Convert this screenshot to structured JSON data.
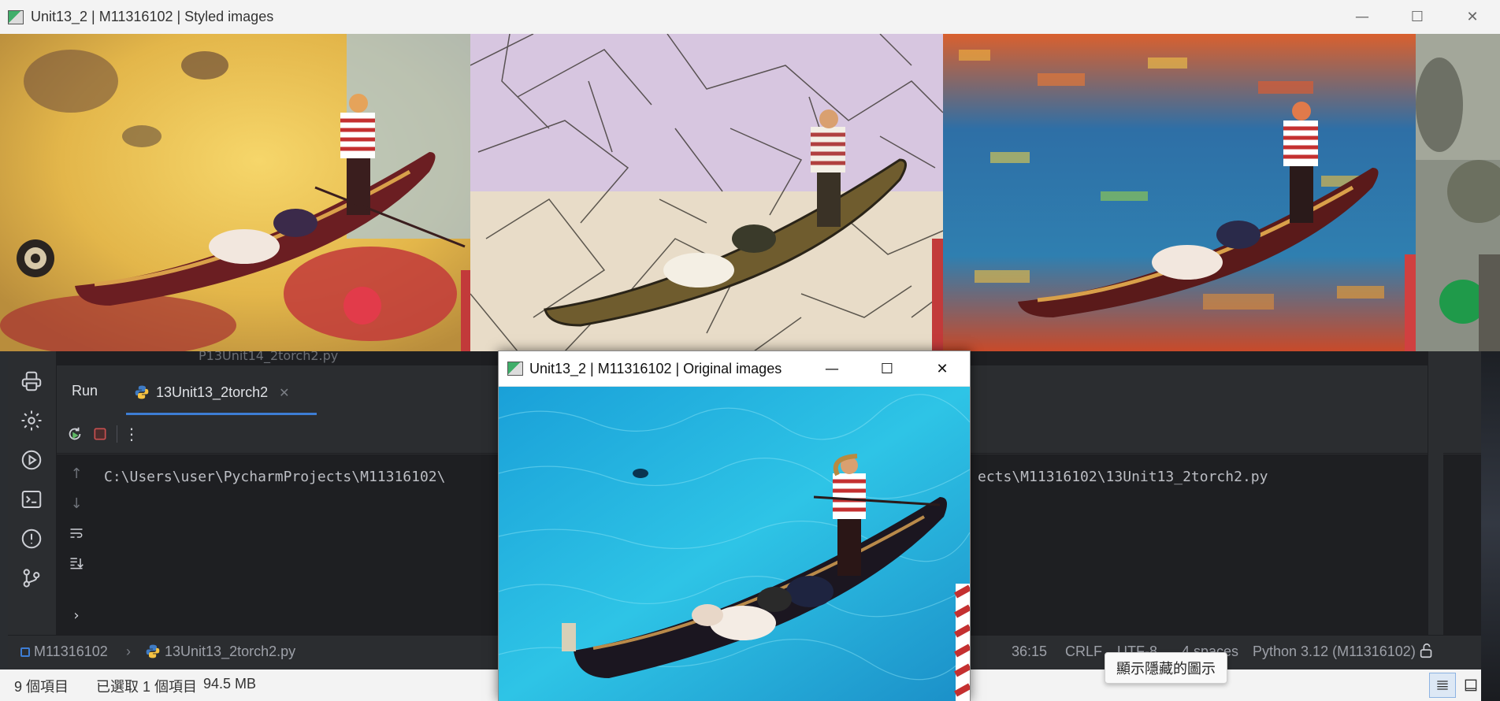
{
  "styled_window": {
    "title": "Unit13_2 | M11316102 | Styled images",
    "controls": [
      "minimize",
      "maximize",
      "close"
    ]
  },
  "styled_images": [
    {
      "name": "gondola-styled-1",
      "style": "painted-warm"
    },
    {
      "name": "gondola-styled-2",
      "style": "mosaic"
    },
    {
      "name": "gondola-styled-3",
      "style": "impressionist"
    },
    {
      "name": "gondola-styled-4",
      "style": "partial"
    }
  ],
  "ide": {
    "editor_tab_ghost": "P13Unit14_2torch2.py",
    "run_label": "Run",
    "run_tab_label": "13Unit13_2torch2",
    "console_line_left": "C:\\Users\\user\\PycharmProjects\\M11316102\\",
    "console_line_right": "ects\\M11316102\\13Unit13_2torch2.py",
    "left_toolbar_icons": [
      "python-packages-icon",
      "services-icon",
      "run-icon",
      "terminal-icon",
      "problems-icon",
      "git-icon"
    ],
    "status": {
      "project": "M11316102",
      "file": "13Unit13_2torch2.py",
      "position": "36:15",
      "line_ending": "CRLF",
      "encoding": "UTF-8",
      "indent": "4 spaces",
      "interpreter": "Python 3.12 (M11316102)"
    }
  },
  "explorer_status": {
    "item_count": "9 個項目",
    "selection": "已選取 1 個項目",
    "size": "94.5 MB"
  },
  "tooltip": "顯示隱藏的圖示",
  "orig_window": {
    "title": "Unit13_2 | M11316102 | Original images"
  },
  "colors": {
    "ide_bg": "#2b2d30",
    "console_bg": "#1e1f22",
    "accent": "#3d7dd4",
    "stop_red": "#c94f4f",
    "rerun_green": "#5fb865"
  }
}
